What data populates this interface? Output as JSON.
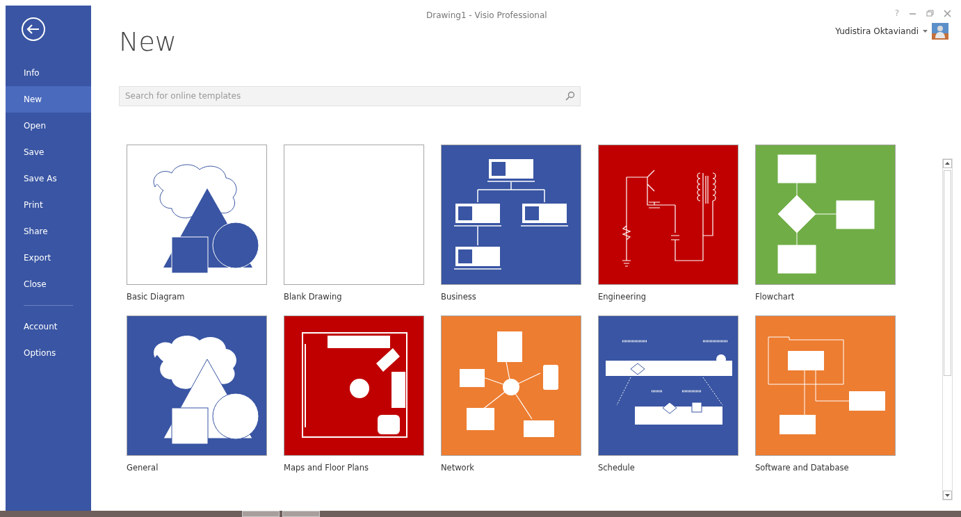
{
  "window": {
    "title": "Drawing1 - Visio Professional",
    "help": "?"
  },
  "account": {
    "user_name": "Yudistira Oktaviandi"
  },
  "sidebar": {
    "items": [
      {
        "label": "Info",
        "selected": false
      },
      {
        "label": "New",
        "selected": true
      },
      {
        "label": "Open",
        "selected": false
      },
      {
        "label": "Save",
        "selected": false
      },
      {
        "label": "Save As",
        "selected": false
      },
      {
        "label": "Print",
        "selected": false
      },
      {
        "label": "Share",
        "selected": false
      },
      {
        "label": "Export",
        "selected": false
      },
      {
        "label": "Close",
        "selected": false
      }
    ],
    "bottom_items": [
      {
        "label": "Account",
        "selected": false
      },
      {
        "label": "Options",
        "selected": false
      }
    ]
  },
  "page_title": "New",
  "search": {
    "placeholder": "Search for online templates"
  },
  "templates": [
    {
      "label": "Basic Diagram",
      "kind": "basic",
      "color": "#ffffff"
    },
    {
      "label": "Blank Drawing",
      "kind": "blank",
      "color": "#ffffff"
    },
    {
      "label": "Business",
      "kind": "business",
      "color": "#3955a3"
    },
    {
      "label": "Engineering",
      "kind": "engineering",
      "color": "#c00000"
    },
    {
      "label": "Flowchart",
      "kind": "flowchart",
      "color": "#70ad47"
    },
    {
      "label": "General",
      "kind": "general",
      "color": "#3955a3"
    },
    {
      "label": "Maps and Floor Plans",
      "kind": "maps",
      "color": "#c00000"
    },
    {
      "label": "Network",
      "kind": "network",
      "color": "#ed7d31"
    },
    {
      "label": "Schedule",
      "kind": "schedule",
      "color": "#3955a3"
    },
    {
      "label": "Software and Database",
      "kind": "software",
      "color": "#ed7d31"
    }
  ]
}
